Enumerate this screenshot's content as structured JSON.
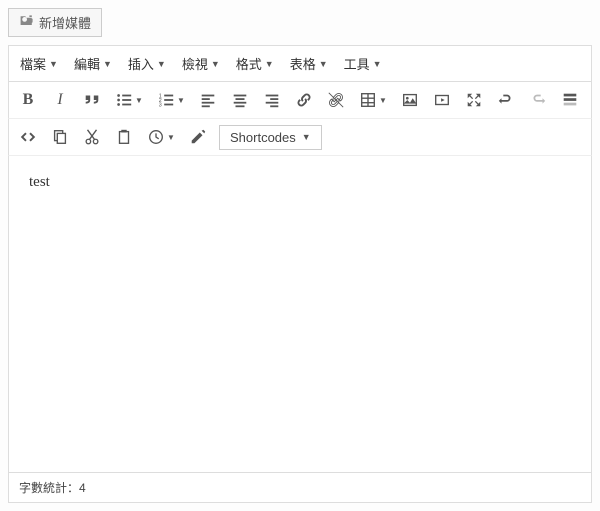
{
  "add_media_label": "新增媒體",
  "menubar": {
    "file": "檔案",
    "edit": "編輯",
    "insert": "插入",
    "view": "檢視",
    "format": "格式",
    "table": "表格",
    "tools": "工具"
  },
  "shortcodes_label": "Shortcodes",
  "editor_content": "test",
  "word_count_label": "字數統計：",
  "word_count_value": "4"
}
